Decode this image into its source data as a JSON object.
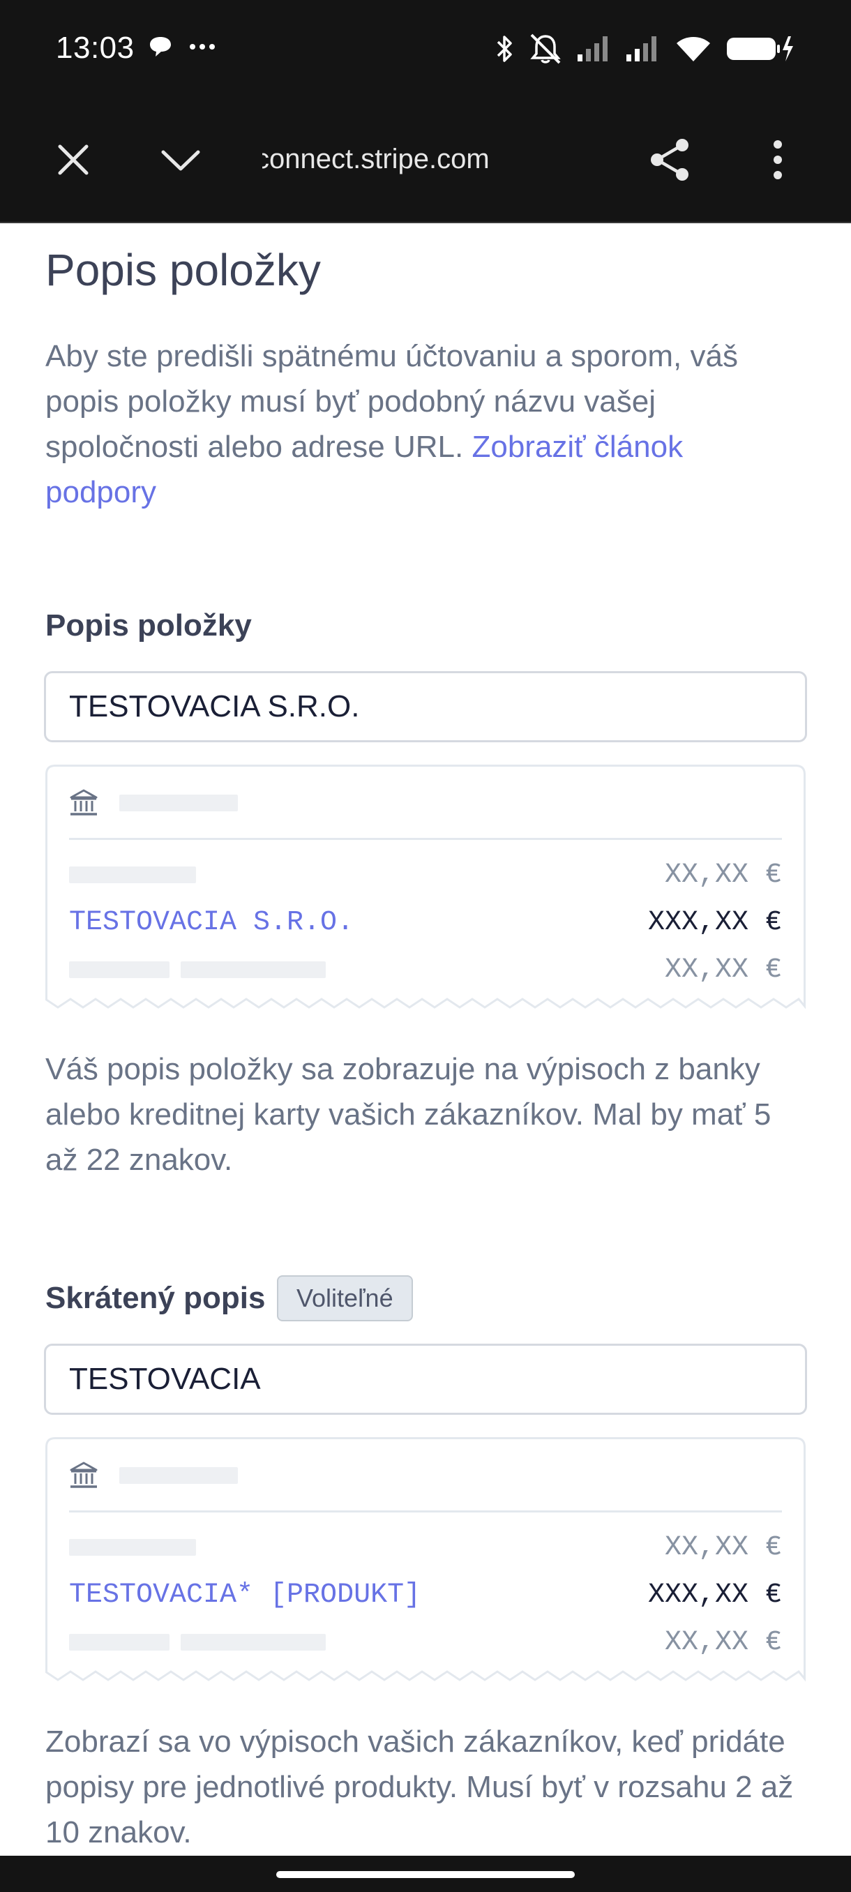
{
  "status_bar": {
    "time": "13:03",
    "left_icons": [
      "chat-bubble-icon",
      "more-dots-icon"
    ],
    "right_icons": [
      "bluetooth-icon",
      "muted-bell-icon",
      "signal-icon",
      "signal-icon",
      "wifi-icon",
      "battery-charging-icon"
    ]
  },
  "browser": {
    "url": "connect.stripe.com",
    "close_icon": "close-icon",
    "collapse_icon": "chevron-down-icon",
    "share_icon": "share-icon",
    "menu_icon": "more-vert-icon"
  },
  "page": {
    "title": "Popis položky",
    "intro_text": "Aby ste predišli spätnému účtovaniu a sporom, váš popis položky musí byť podobný názvu vašej spoločnosti alebo adrese URL. ",
    "intro_link": "Zobraziť článok podpory"
  },
  "descriptor": {
    "label": "Popis položky",
    "value": "TESTOVACIA S.R.O.",
    "preview": {
      "bank_icon": "bank-icon",
      "row1_amount": "XX,XX €",
      "row2_desc": "TESTOVACIA S.R.O.",
      "row2_amount": "XXX,XX €",
      "row3_amount": "XX,XX €"
    },
    "help": "Váš popis položky sa zobrazuje na výpisoch z banky alebo kreditnej karty vašich zákazníkov. Mal by mať 5 až 22 znakov."
  },
  "short_descriptor": {
    "label": "Skrátený popis",
    "badge": "Voliteľné",
    "value": "TESTOVACIA",
    "preview": {
      "bank_icon": "bank-icon",
      "row1_amount": "XX,XX €",
      "row2_desc": "TESTOVACIA* [PRODUKT]",
      "row2_amount": "XXX,XX €",
      "row3_amount": "XX,XX €"
    },
    "help": "Zobrazí sa vo výpisoch vašich zákazníkov, keď pridáte popisy pre jednotlivé produkty. Musí byť v rozsahu 2 až 10 znakov."
  },
  "colors": {
    "link": "#6772e5",
    "text": "#3c4257",
    "muted": "#697386",
    "bar": "#141414"
  }
}
